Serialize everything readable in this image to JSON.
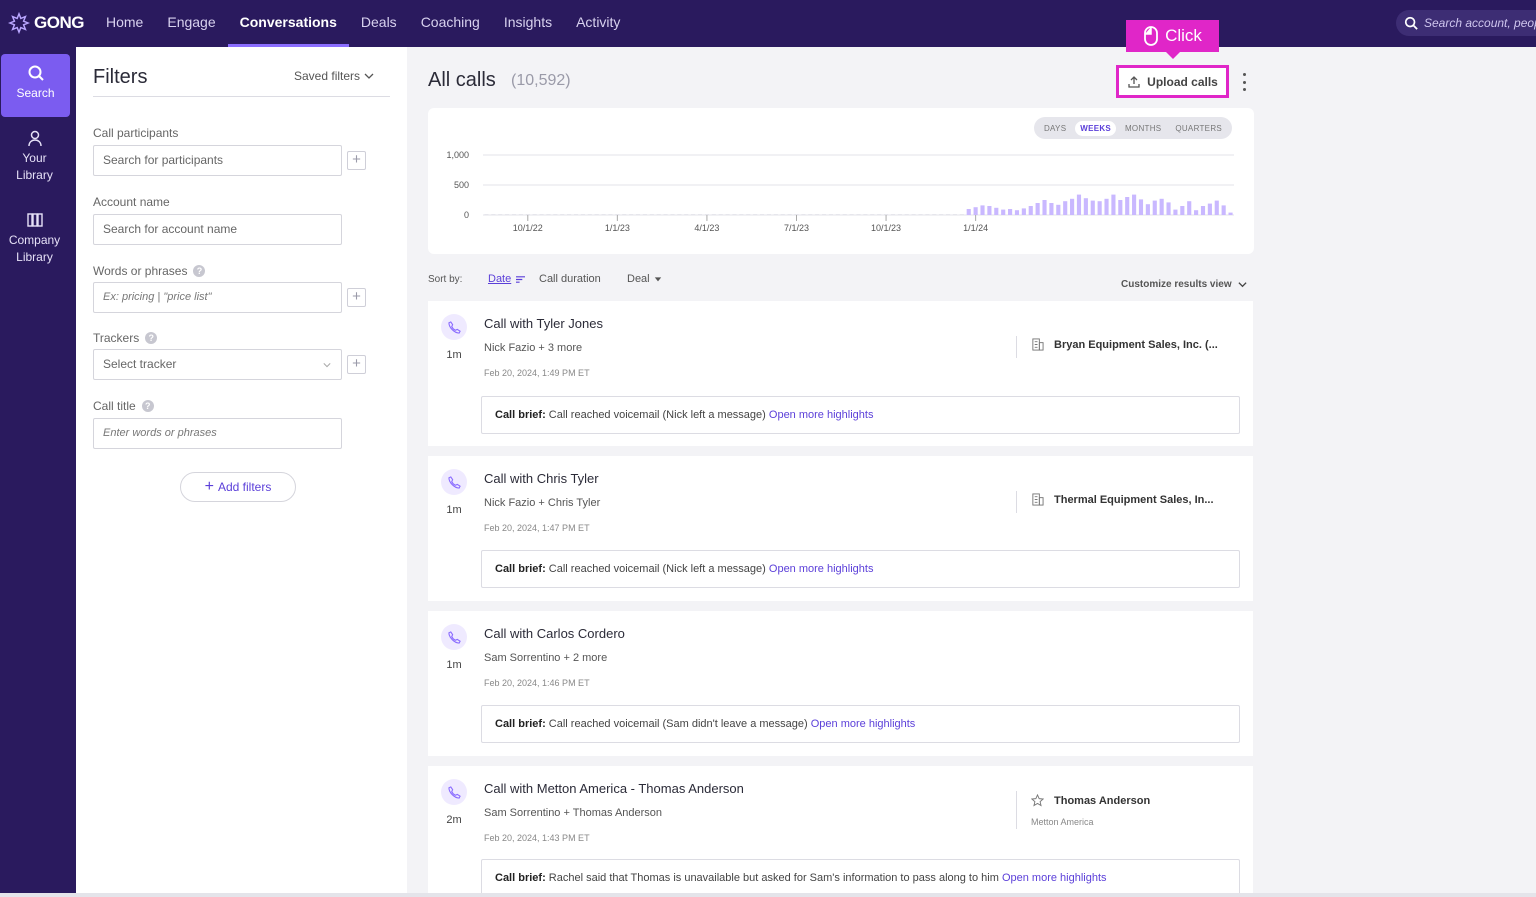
{
  "nav": {
    "logo": "GONG",
    "links": [
      "Home",
      "Engage",
      "Conversations",
      "Deals",
      "Coaching",
      "Insights",
      "Activity"
    ],
    "active": "Conversations",
    "search_placeholder": "Search account, peopl"
  },
  "rail": {
    "search": "Search",
    "library": [
      "Your",
      "Library"
    ],
    "company": [
      "Company",
      "Library"
    ]
  },
  "filters": {
    "title": "Filters",
    "saved": "Saved filters",
    "participants_label": "Call participants",
    "participants_placeholder": "Search for participants",
    "account_label": "Account name",
    "account_placeholder": "Search for account name",
    "words_label": "Words or phrases",
    "words_placeholder": "Ex: pricing | \"price list\"",
    "trackers_label": "Trackers",
    "trackers_placeholder": "Select tracker",
    "title_label": "Call title",
    "title_placeholder": "Enter words or phrases",
    "add": "Add filters"
  },
  "main": {
    "title": "All calls",
    "count": "(10,592)",
    "upload": "Upload calls",
    "tooltip": "Click",
    "periods": [
      "DAYS",
      "WEEKS",
      "MONTHS",
      "QUARTERS"
    ],
    "active_period": "WEEKS",
    "sort_label": "Sort by:",
    "sort_options": [
      "Date",
      "Call duration",
      "Deal"
    ],
    "customize": "Customize results view"
  },
  "chart_data": {
    "type": "bar",
    "ylim": [
      0,
      1000
    ],
    "yticks": [
      {
        "v": 1000,
        "label": "1,000"
      },
      {
        "v": 500,
        "label": "500"
      },
      {
        "v": 0,
        "label": "0"
      }
    ],
    "xticks": [
      "10/1/22",
      "1/1/23",
      "4/1/23",
      "7/1/23",
      "10/1/23",
      "1/1/24"
    ],
    "weeks_per_tick": 13,
    "first_tick_week": 6,
    "values": [
      0,
      0,
      0,
      0,
      0,
      0,
      0,
      0,
      0,
      0,
      0,
      0,
      0,
      0,
      0,
      0,
      0,
      0,
      0,
      0,
      0,
      0,
      0,
      0,
      0,
      0,
      0,
      0,
      0,
      0,
      0,
      0,
      0,
      0,
      0,
      0,
      0,
      0,
      0,
      0,
      0,
      0,
      0,
      0,
      0,
      0,
      0,
      0,
      0,
      0,
      0,
      0,
      0,
      0,
      0,
      0,
      0,
      0,
      0,
      0,
      0,
      0,
      0,
      0,
      0,
      0,
      0,
      0,
      0,
      0,
      100,
      130,
      160,
      150,
      120,
      90,
      100,
      80,
      110,
      150,
      200,
      250,
      200,
      170,
      230,
      270,
      340,
      280,
      240,
      230,
      270,
      340,
      250,
      300,
      340,
      260,
      180,
      240,
      270,
      210,
      90,
      150,
      230,
      80,
      150,
      190,
      240,
      160,
      40
    ]
  },
  "calls": [
    {
      "title": "Call with Tyler Jones",
      "participants": "Nick Fazio + 3 more",
      "date": "Feb 20, 2024, 1:49 PM ET",
      "duration": "1m",
      "account": "Bryan Equipment Sales, Inc. (...",
      "account_icon": "building-icon",
      "account_sub": "",
      "brief_label": "Call brief:",
      "brief": "Call reached voicemail (Nick left a message)",
      "link": "Open more highlights"
    },
    {
      "title": "Call with Chris Tyler",
      "participants": "Nick Fazio + Chris Tyler",
      "date": "Feb 20, 2024, 1:47 PM ET",
      "duration": "1m",
      "account": "Thermal Equipment Sales, In...",
      "account_icon": "building-icon",
      "account_sub": "",
      "brief_label": "Call brief:",
      "brief": "Call reached voicemail (Nick left a message)",
      "link": "Open more highlights"
    },
    {
      "title": "Call with Carlos Cordero",
      "participants": "Sam Sorrentino + 2 more",
      "date": "Feb 20, 2024, 1:46 PM ET",
      "duration": "1m",
      "account": "",
      "account_icon": "",
      "account_sub": "",
      "brief_label": "Call brief:",
      "brief": "Call reached voicemail (Sam didn't leave a message)",
      "link": "Open more highlights"
    },
    {
      "title": "Call with Metton America - Thomas Anderson",
      "participants": "Sam Sorrentino + Thomas Anderson",
      "date": "Feb 20, 2024, 1:43 PM ET",
      "duration": "2m",
      "account": "Thomas Anderson",
      "account_icon": "star-icon",
      "account_sub": "Metton America",
      "brief_label": "Call brief:",
      "brief": "Rachel said that Thomas is unavailable but asked for Sam's information to pass along to him",
      "link": "Open more highlights"
    }
  ],
  "colors": {
    "nav_bg": "#2a1a5e",
    "accent": "#7b5cf0",
    "link": "#5b3fd9",
    "bars": "#c9b8ff",
    "highlight": "#e026c8"
  }
}
